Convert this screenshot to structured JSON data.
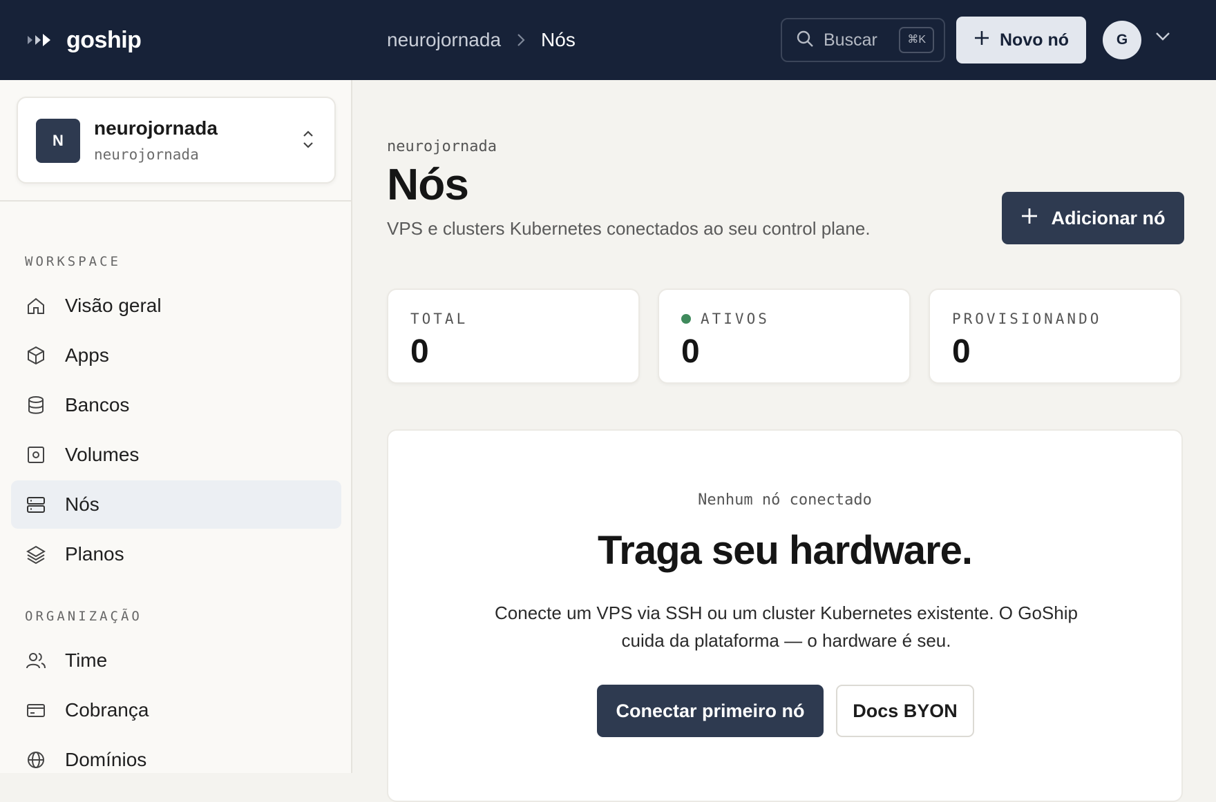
{
  "app": {
    "name": "goship"
  },
  "breadcrumb": {
    "workspace": "neurojornada",
    "current": "Nós"
  },
  "search": {
    "label": "Buscar",
    "shortcut": "⌘K"
  },
  "header": {
    "new_node_label": "Novo nó",
    "avatar_initial": "G"
  },
  "workspace": {
    "initial": "N",
    "name": "neurojornada",
    "slug": "neurojornada"
  },
  "sidebar": {
    "workspace_section": "WORKSPACE",
    "workspace_items": [
      {
        "label": "Visão geral",
        "icon": "home-icon"
      },
      {
        "label": "Apps",
        "icon": "box-icon"
      },
      {
        "label": "Bancos",
        "icon": "database-icon"
      },
      {
        "label": "Volumes",
        "icon": "disk-icon"
      },
      {
        "label": "Nós",
        "icon": "server-icon",
        "active": true
      },
      {
        "label": "Planos",
        "icon": "layers-icon"
      }
    ],
    "org_section": "ORGANIZAÇÃO",
    "org_items": [
      {
        "label": "Time",
        "icon": "users-icon"
      },
      {
        "label": "Cobrança",
        "icon": "credit-card-icon"
      },
      {
        "label": "Domínios",
        "icon": "globe-icon"
      }
    ]
  },
  "page": {
    "kicker": "neurojornada",
    "title": "Nós",
    "description": "VPS e clusters Kubernetes conectados ao seu control plane.",
    "add_button": "Adicionar nó"
  },
  "stats": [
    {
      "label": "TOTAL",
      "value": "0"
    },
    {
      "label": "ATIVOS",
      "value": "0",
      "status_color": "#3f8a5c"
    },
    {
      "label": "PROVISIONANDO",
      "value": "0"
    }
  ],
  "empty_state": {
    "kicker": "Nenhum nó conectado",
    "title": "Traga seu hardware.",
    "description": "Conecte um VPS via SSH ou um cluster Kubernetes existente. O GoShip cuida da plataforma — o hardware é seu.",
    "primary_button": "Conectar primeiro nó",
    "secondary_button": "Docs BYON"
  },
  "colors": {
    "topbar": "#172238",
    "accent": "#2e3a50",
    "active_status": "#3f8a5c"
  }
}
